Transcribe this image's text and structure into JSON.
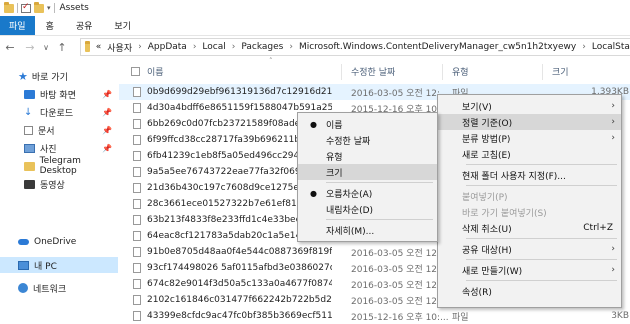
{
  "window": {
    "title": "Assets"
  },
  "ribbon": {
    "tabs": [
      "파일",
      "홈",
      "공유",
      "보기"
    ]
  },
  "address": {
    "overflow": "«",
    "crumbs": [
      "사용자",
      "AppData",
      "Local",
      "Packages",
      "Microsoft.Windows.ContentDeliveryManager_cw5n1h2txyewy",
      "LocalState"
    ]
  },
  "nav": {
    "quick_access": "바로 가기",
    "items": [
      {
        "label": "바탕 화면",
        "icon": "desktop-icon",
        "pinned": true
      },
      {
        "label": "다운로드",
        "icon": "download-icon",
        "pinned": true
      },
      {
        "label": "문서",
        "icon": "document-icon",
        "pinned": true
      },
      {
        "label": "사진",
        "icon": "picture-icon",
        "pinned": true
      },
      {
        "label": "Telegram Desktop",
        "icon": "folder-icon",
        "pinned": false
      },
      {
        "label": "동영상",
        "icon": "video-icon",
        "pinned": false
      }
    ],
    "onedrive": "OneDrive",
    "this_pc": "내 PC",
    "network": "네트워크"
  },
  "columns": {
    "name": "이름",
    "date": "수정한 날짜",
    "type": "유형",
    "size": "크기"
  },
  "files": [
    {
      "name": "0b9d699d29ebf961319136d7c12916d2132...",
      "date": "2016-03-05 오전 12:...",
      "type": "파일",
      "size": "1,393KB"
    },
    {
      "name": "4d30a4bdff6e8651159f1588047b591a252a",
      "date": "2015-12-16 오후 10:...",
      "type": "",
      "size": ""
    },
    {
      "name": "6bb269c0d07fcb23721589f08ade61e2",
      "date": "",
      "type": "",
      "size": ""
    },
    {
      "name": "6f99ffcd38cc28717fa39b696211bae8",
      "date": "",
      "type": "",
      "size": ""
    },
    {
      "name": "6fb41239c1eb8f5a05ed496cc2945b6",
      "date": "",
      "type": "",
      "size": ""
    },
    {
      "name": "9a5a5ee76743722eae77fa32f0695a82",
      "date": "",
      "type": "",
      "size": ""
    },
    {
      "name": "21d36b430c197c7608d9ce1275ebbc",
      "date": "",
      "type": "",
      "size": ""
    },
    {
      "name": "28c3661ece01527322b7e61ef816d6",
      "date": "",
      "type": "",
      "size": ""
    },
    {
      "name": "63b213f4833f8e233ffd1c4e33beeff9",
      "date": "",
      "type": "",
      "size": ""
    },
    {
      "name": "64eac8cf121783a5dab20c1a5e14114",
      "date": "",
      "type": "",
      "size": ""
    },
    {
      "name": "91b0e8705d48aa0f4e544c0887369f819f9d",
      "date": "2016-03-05 오전 12:...",
      "type": "",
      "size": ""
    },
    {
      "name": "93cf174498026 5af0115afbd3e0386027c53c",
      "date": "2016-03-05 오전 12:...",
      "type": "",
      "size": ""
    },
    {
      "name": "674c82e9014f3d50a5c133a0a4677f0874ad",
      "date": "2016-03-05 오전 12:...",
      "type": "",
      "size": ""
    },
    {
      "name": "2102c161846c031477f662242b722b5d2fcf...",
      "date": "2016-03-05 오전 12:...",
      "type": "",
      "size": ""
    },
    {
      "name": "43399e8cfdc9ac47fc0bf385b3669ecf51181...",
      "date": "2015-12-16 오후 10:...",
      "type": "파일",
      "size": "3KB"
    }
  ],
  "context_menu": {
    "items": [
      {
        "label": "보기(V)",
        "submenu": true
      },
      {
        "label": "정렬 기준(O)",
        "submenu": true,
        "highlight": true
      },
      {
        "label": "분류 방법(P)",
        "submenu": true
      },
      {
        "label": "새로 고침(E)"
      },
      {
        "sep": true
      },
      {
        "label": "현재 폴더 사용자 지정(F)..."
      },
      {
        "sep": true
      },
      {
        "label": "붙여넣기(P)",
        "disabled": true
      },
      {
        "label": "바로 가기 붙여넣기(S)",
        "disabled": true
      },
      {
        "label": "삭제 취소(U)",
        "shortcut": "Ctrl+Z"
      },
      {
        "sep": true
      },
      {
        "label": "공유 대상(H)",
        "submenu": true
      },
      {
        "sep": true
      },
      {
        "label": "새로 만들기(W)",
        "submenu": true
      },
      {
        "sep": true
      },
      {
        "label": "속성(R)"
      }
    ]
  },
  "sort_submenu": {
    "items": [
      {
        "label": "이름",
        "checked": true
      },
      {
        "label": "수정한 날짜"
      },
      {
        "label": "유형"
      },
      {
        "label": "크기",
        "highlight": true
      },
      {
        "sep": true
      },
      {
        "label": "오름차순(A)",
        "checked": true
      },
      {
        "label": "내림차순(D)"
      },
      {
        "sep": true
      },
      {
        "label": "자세히(M)..."
      }
    ]
  }
}
